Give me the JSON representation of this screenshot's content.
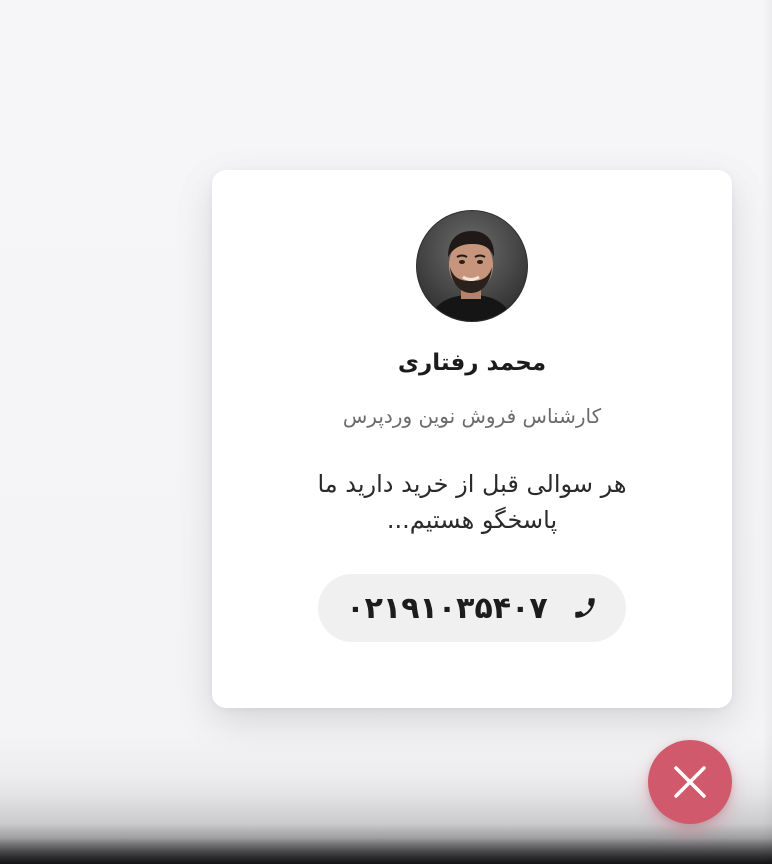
{
  "card": {
    "agent_name": "محمد رفتاری",
    "agent_role": "کارشناس فروش نوین وردپرس",
    "message": "هر سوالی قبل از خرید دارید ما پاسخگو هستیم...",
    "phone_number": "۰۲۱۹۱۰۳۵۴۰۷",
    "avatar_icon": "agent-avatar-photo",
    "phone_icon": "phone-icon"
  },
  "fab": {
    "icon": "close-icon",
    "color": "#d05a6c"
  }
}
